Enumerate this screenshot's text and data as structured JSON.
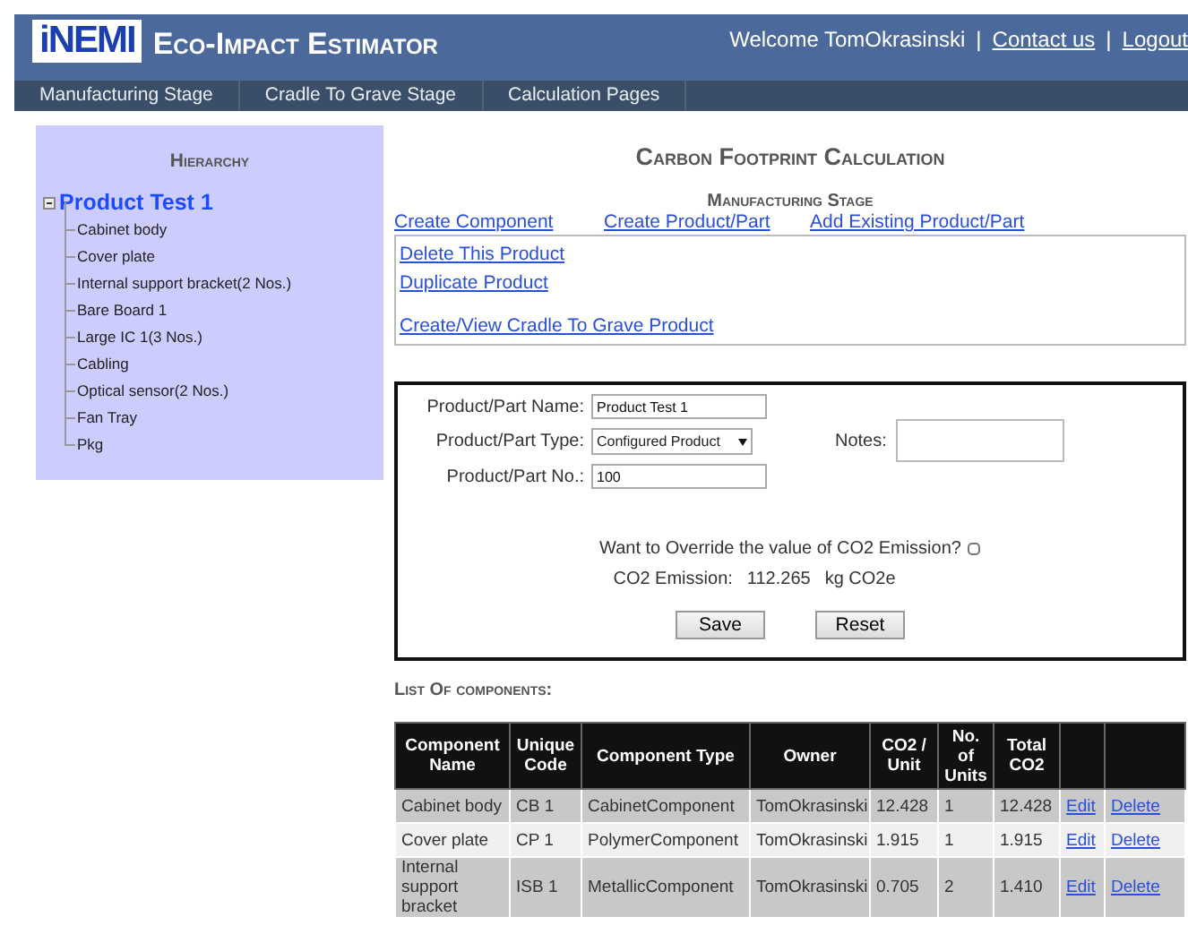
{
  "header": {
    "logo": "iNEMI",
    "title": "Eco-Impact Estimator",
    "welcome": "Welcome TomOkrasinski",
    "links": [
      {
        "separator": "|",
        "label": "Contact us"
      },
      {
        "separator": "|",
        "label": "Logout"
      }
    ]
  },
  "nav": [
    {
      "label": "Manufacturing Stage",
      "selected": false
    },
    {
      "label": "Cradle To Grave Stage",
      "selected": false
    },
    {
      "label": "Calculation Pages",
      "selected": false
    }
  ],
  "sidebar": {
    "heading": "Hierarchy",
    "tree": [
      {
        "label": "Product Test 1",
        "expanded": true,
        "children": [
          {
            "label": "Cabinet body"
          },
          {
            "label": "Cover plate"
          },
          {
            "label": "Internal support bracket(2 Nos.)"
          },
          {
            "label": "Bare Board 1"
          },
          {
            "label": "Large IC 1(3 Nos.)"
          },
          {
            "label": "Cabling"
          },
          {
            "label": "Optical sensor(2 Nos.)"
          },
          {
            "label": "Fan Tray"
          },
          {
            "label": "Pkg"
          }
        ]
      }
    ]
  },
  "main": {
    "title": "Carbon Footprint Calculation",
    "subtitle": "Manufacturing Stage",
    "links": [
      "Create Component",
      "Create Product/Part",
      "Add Existing Product/Part"
    ],
    "actions": [
      "Delete This Product",
      "Duplicate Product",
      "Create/View Cradle To Grave Product"
    ],
    "form": {
      "fields": [
        {
          "kind": "text",
          "label": "Product/Part Name:",
          "value": "Product Test 1"
        },
        {
          "kind": "select",
          "label": "Product/Part Type:",
          "value": "Configured Product"
        },
        {
          "kind": "text",
          "label": "Product/Part No.:",
          "value": "100"
        }
      ],
      "notes": {
        "label": "Notes:"
      },
      "override": {
        "label": "Want to Override the value of CO2 Emission?",
        "checked": false
      },
      "emission": {
        "label": "CO2 Emission:",
        "value": "112.265",
        "unit": "kg CO2e"
      },
      "buttons": [
        "Save",
        "Reset"
      ]
    },
    "list_heading": "List Of components:",
    "table": {
      "columns": [
        "Component Name",
        "Unique Code",
        "Component Type",
        "Owner",
        "CO2 / Unit",
        "No. of Units",
        "Total CO2"
      ],
      "rows": [
        {
          "cells": [
            "Cabinet body",
            "CB 1",
            "CabinetComponent",
            "TomOkrasinski",
            "12.428",
            "1",
            "12.428"
          ],
          "actions": [
            "Edit",
            "Delete"
          ]
        },
        {
          "cells": [
            "Cover plate",
            "CP 1",
            "PolymerComponent",
            "TomOkrasinski",
            "1.915",
            "1",
            "1.915"
          ],
          "actions": [
            "Edit",
            "Delete"
          ]
        },
        {
          "cells": [
            "Internal support bracket",
            "ISB 1",
            "MetallicComponent",
            "TomOkrasinski",
            "0.705",
            "2",
            "1.410"
          ],
          "actions": [
            "Edit",
            "Delete"
          ]
        }
      ]
    }
  }
}
